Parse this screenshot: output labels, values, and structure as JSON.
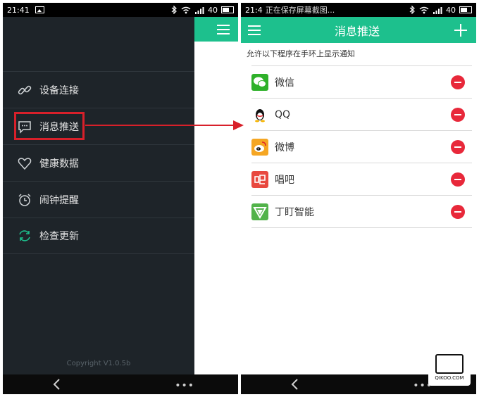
{
  "left_screen": {
    "status": {
      "time": "21:41",
      "signal_text": "40"
    },
    "menu": [
      {
        "label": "设备连接",
        "icon": "link-icon"
      },
      {
        "label": "消息推送",
        "icon": "message-icon"
      },
      {
        "label": "健康数据",
        "icon": "heart-icon"
      },
      {
        "label": "闹钟提醒",
        "icon": "alarm-clock-icon"
      },
      {
        "label": "检查更新",
        "icon": "refresh-icon"
      }
    ],
    "copyright": "Copyright V1.0.5b"
  },
  "right_screen": {
    "status": {
      "time": "21:4",
      "notification": "正在保存屏幕截图...",
      "signal_text": "40"
    },
    "title": "消息推送",
    "section_label": "允许以下程序在手环上显示通知",
    "apps": [
      {
        "name": "微信",
        "icon": "wechat-icon",
        "color": "#2fb12a"
      },
      {
        "name": "QQ",
        "icon": "qq-penguin-icon",
        "color": "#111111"
      },
      {
        "name": "微博",
        "icon": "weibo-icon",
        "color": "#f5a623"
      },
      {
        "name": "唱吧",
        "icon": "changba-icon",
        "color": "#e8483f"
      },
      {
        "name": "丁盯智能",
        "icon": "dingding-icon",
        "color": "#52b34a"
      }
    ]
  },
  "colors": {
    "accent": "#1dc08d",
    "drawer_bg": "#1e2429",
    "remove": "#e8283a",
    "highlight": "#d8202a"
  },
  "watermark": {
    "text": "QIKOO.COM"
  }
}
